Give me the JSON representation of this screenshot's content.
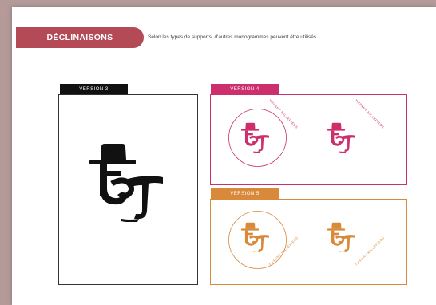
{
  "section": {
    "title": "DÉCLINAISONS",
    "description": "Selon les types de supports, d'autres monogrammes peuvent être utilisés."
  },
  "versions": [
    {
      "label": "VERSION 3",
      "color": "#111111"
    },
    {
      "label": "VERSION 4",
      "color": "#cc2f6b"
    },
    {
      "label": "VERSION 5",
      "color": "#d8893a"
    }
  ],
  "badge_text": "TIFFANY MILLEPIEDS",
  "colors": {
    "accent": "#b34a55",
    "page_bg": "#b49b9a",
    "pink": "#cc2f6b",
    "orange": "#d8893a"
  }
}
